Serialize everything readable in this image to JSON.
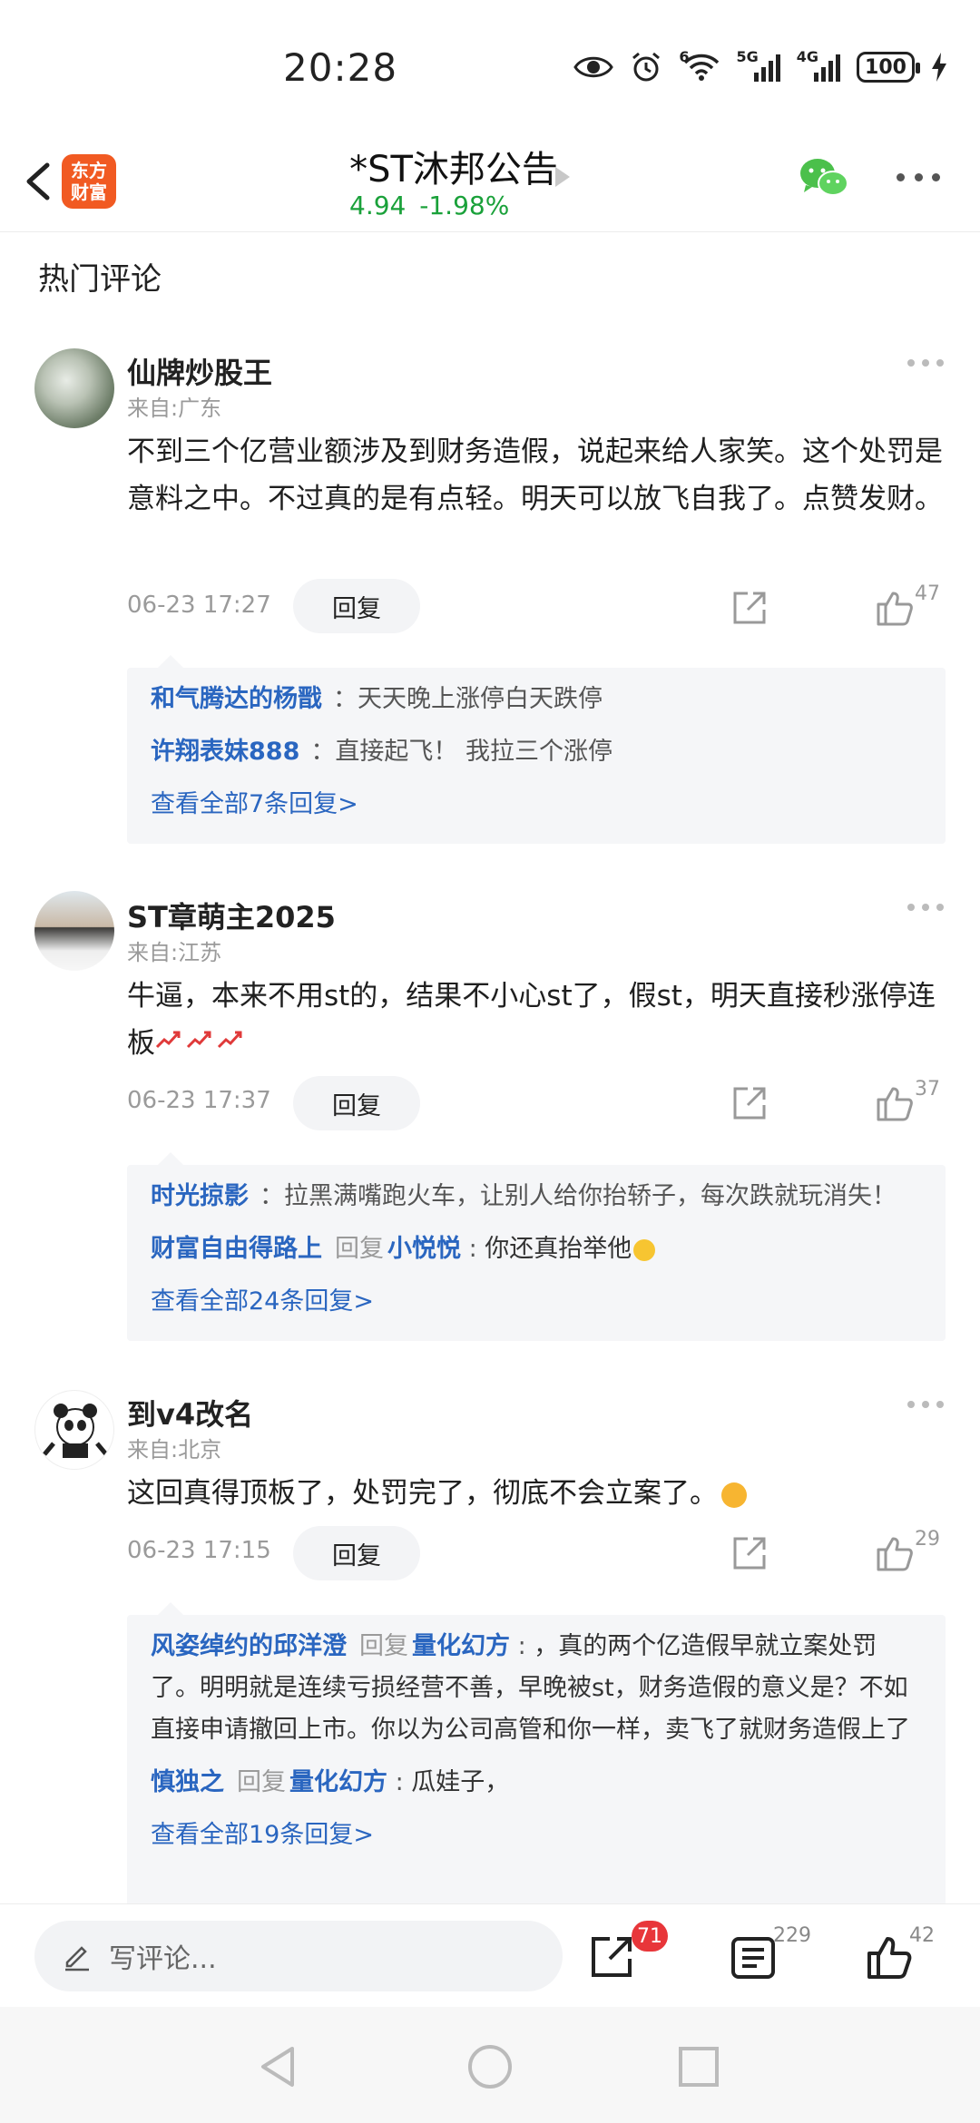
{
  "status_bar": {
    "time": "20:28",
    "battery": "100",
    "net_labels": [
      "6",
      "5G",
      "4G"
    ]
  },
  "header": {
    "app_logo_text": [
      "东方",
      "财富"
    ],
    "title": "*ST沐邦公告",
    "price": "4.94",
    "change": "-1.98%"
  },
  "section_title": "热门评论",
  "comments": [
    {
      "username": "仙牌炒股王",
      "location": "来自:广东",
      "content": "不到三个亿营业额涉及到财务造假，说起来给人家笑。这个处罚是意料之中。不过真的是有点轻。明天可以放飞自我了。点赞发财。",
      "time": "06-23 17:27",
      "reply_label": "回复",
      "likes": "47",
      "replies": [
        {
          "name": "和气腾达的杨戬",
          "text": "：天天晚上涨停白天跌停"
        },
        {
          "name": "许翔表妹888",
          "text": "：直接起飞！ 我拉三个涨停"
        }
      ],
      "view_all": "查看全部7条回复>"
    },
    {
      "username": "ST章萌主2025",
      "location": "来自:江苏",
      "content": "牛逼，本来不用st的，结果不小心st了，假st，明天直接秒涨停连板",
      "time": "06-23 17:37",
      "reply_label": "回复",
      "likes": "37",
      "replies": [
        {
          "name": "时光掠影",
          "text": "：拉黑满嘴跑火车，让别人给你抬轿子，每次跌就玩消失！"
        },
        {
          "name": "财富自由得路上",
          "verb": "回复",
          "target": "小悦悦",
          "text": "你还真抬举他"
        }
      ],
      "view_all": "查看全部24条回复>"
    },
    {
      "username": "到v4改名",
      "location": "来自:北京",
      "content": "这回真得顶板了，处罚完了，彻底不会立案了。",
      "time": "06-23 17:15",
      "reply_label": "回复",
      "likes": "29",
      "replies": [
        {
          "name": "风姿绰约的邱洋澄",
          "verb": "回复",
          "target": "量化幻方",
          "text": "，真的两个亿造假早就立案处罚了。明明就是连续亏损经营不善，早晚被st，财务造假的意义是？不如直接申请撤回上市。你以为公司高管和你一样，卖飞了就财务造假上了"
        },
        {
          "name": "慎独之",
          "verb": "回复",
          "target": "量化幻方",
          "text": "瓜娃子，"
        }
      ],
      "view_all": "查看全部19条回复>"
    }
  ],
  "bottom_bar": {
    "comment_placeholder": "写评论...",
    "share_badge": "71",
    "comments_count": "229",
    "likes_count": "42"
  },
  "colors": {
    "quote_green": "#1aa13a",
    "link_blue": "#2a66c0",
    "badge_red": "#e8363a",
    "brand_orange": "#f15a22"
  }
}
